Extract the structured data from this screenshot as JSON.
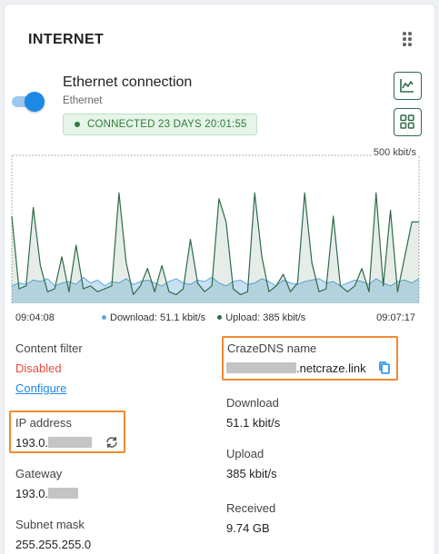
{
  "card": {
    "title": "INTERNET"
  },
  "connection": {
    "name": "Ethernet connection",
    "type": "Ethernet",
    "status": "CONNECTED 23 DAYS 20:01:55",
    "enabled": true
  },
  "chart_data": {
    "type": "area",
    "series": [
      {
        "name": "Download",
        "color": "#5fa8dc",
        "values": [
          60,
          70,
          65,
          80,
          75,
          85,
          60,
          70,
          75,
          65,
          90,
          70,
          80,
          60,
          75,
          70,
          85,
          65,
          75,
          80,
          70,
          60,
          75,
          85,
          70,
          65,
          80,
          75,
          90,
          70,
          60,
          75,
          80,
          65,
          70,
          85,
          75,
          60,
          80,
          70,
          65,
          75,
          80,
          85,
          70,
          75,
          60,
          70,
          80,
          75,
          65,
          85,
          70,
          60,
          75,
          80,
          70,
          85
        ]
      },
      {
        "name": "Upload",
        "color": "#2e6b47",
        "values": [
          300,
          50,
          60,
          330,
          130,
          40,
          50,
          160,
          40,
          200,
          50,
          60,
          40,
          50,
          60,
          380,
          140,
          30,
          60,
          120,
          40,
          130,
          40,
          30,
          50,
          220,
          70,
          40,
          60,
          360,
          280,
          50,
          30,
          40,
          380,
          160,
          40,
          60,
          100,
          40,
          70,
          380,
          140,
          40,
          50,
          300,
          60,
          40,
          60,
          120,
          40,
          380,
          60,
          320,
          40,
          160,
          280,
          280
        ]
      }
    ],
    "y_max_label": "500 kbit/s",
    "ylim": [
      0,
      500
    ],
    "x_start": "09:04:08",
    "x_end": "09:07:17",
    "legend": {
      "download": "Download: 51.1 kbit/s",
      "upload": "Upload: 385 kbit/s"
    }
  },
  "details": {
    "content_filter": {
      "label": "Content filter",
      "value": "Disabled",
      "action": "Configure"
    },
    "ip_address": {
      "label": "IP address",
      "value": "193.0."
    },
    "gateway": {
      "label": "Gateway",
      "value": "193.0."
    },
    "subnet_mask": {
      "label": "Subnet mask",
      "value": "255.255.255.0"
    },
    "cazedns": {
      "label": "CrazeDNS name",
      "value": ".netcraze.link"
    },
    "download": {
      "label": "Download",
      "value": "51.1 kbit/s"
    },
    "upload": {
      "label": "Upload",
      "value": "385 kbit/s"
    },
    "received": {
      "label": "Received",
      "value": "9.74 GB"
    }
  }
}
